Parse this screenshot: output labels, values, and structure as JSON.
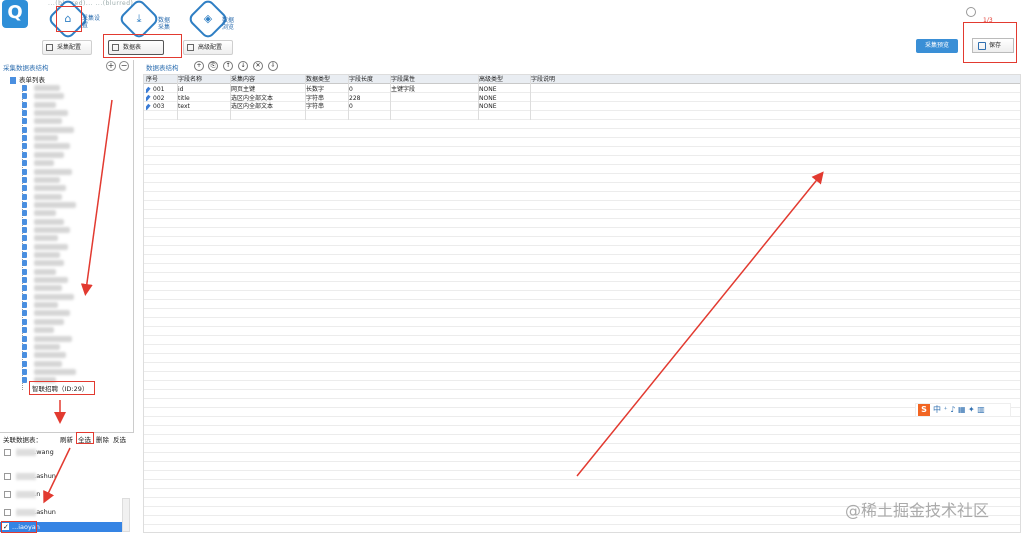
{
  "title_bar": {
    "text": "...(blurred)... ...(blurred)..."
  },
  "nav": {
    "home_label": "采集设置",
    "collect_label": "数据采集",
    "browse_label": "数据浏览"
  },
  "toolbar": {
    "collect_config": "采集配置",
    "data_tables": "数据表",
    "advanced_config": "高级配置",
    "preview": "采集预览",
    "save": "保存",
    "version": "1/3"
  },
  "left": {
    "header": "采集数据表结构",
    "root": "表单列表",
    "tree_count": 36,
    "selected_node": "智联招聘（ID:29）"
  },
  "related": {
    "header": "关联数据表：",
    "actions": [
      "刷新",
      "全选",
      "删除",
      "反选"
    ],
    "items": [
      "...wang",
      "...ashun",
      "...n",
      "...ashun"
    ],
    "selected": "...iaoyan"
  },
  "right": {
    "header": "数据表结构",
    "columns": [
      "序号",
      "字段名称",
      "采集内容",
      "数据类型",
      "字段长度",
      "字段属性",
      "高级类型",
      "字段说明"
    ],
    "rows": [
      [
        "001",
        "id",
        "网页主键",
        "长数字",
        "0",
        "主键字段",
        "NONE",
        ""
      ],
      [
        "002",
        "title",
        "选区内全部文本",
        "字符串",
        "228",
        "",
        "NONE",
        ""
      ],
      [
        "003",
        "text",
        "选区内全部文本",
        "字符串",
        "0",
        "",
        "NONE",
        ""
      ]
    ]
  },
  "ime": {
    "logo": "S",
    "mode": "中"
  },
  "watermark": "@稀土掘金技术社区",
  "colors": {
    "accent": "#2f7fc4",
    "annotation": "#e23a30",
    "selection": "#3584e4"
  }
}
